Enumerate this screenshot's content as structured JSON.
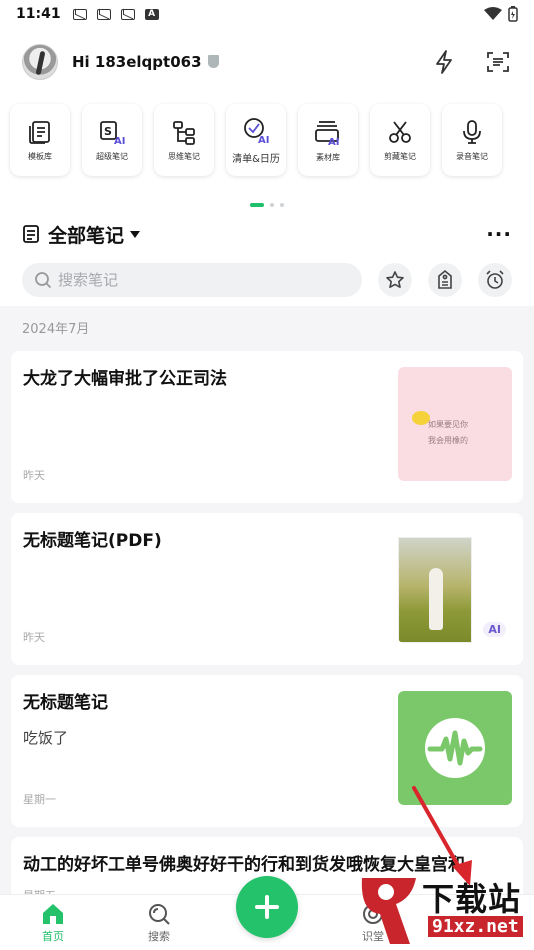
{
  "status": {
    "time": "11:41"
  },
  "header": {
    "username": "Hi 183elqpt063"
  },
  "tools": [
    {
      "label": "模板库",
      "icon": "template-library-icon"
    },
    {
      "label": "超级笔记",
      "icon": "super-note-ai-icon"
    },
    {
      "label": "思维笔记",
      "icon": "mind-map-icon"
    },
    {
      "label": "清单&日历",
      "icon": "checklist-calendar-ai-icon"
    },
    {
      "label": "素材库",
      "icon": "material-library-ai-icon"
    },
    {
      "label": "剪藏笔记",
      "icon": "clip-scissors-icon"
    },
    {
      "label": "录音笔记",
      "icon": "microphone-icon"
    }
  ],
  "section": {
    "title": "全部笔记",
    "more": "···"
  },
  "search": {
    "placeholder": "搜索笔记"
  },
  "date_group": "2024年7月",
  "notes": [
    {
      "title": "大龙了大幅审批了公正司法",
      "body": "",
      "date": "昨天",
      "thumb_text_1": "如果要见你",
      "thumb_text_2": "我会用橡的"
    },
    {
      "title": "无标题笔记(PDF)",
      "body": "",
      "date": "昨天",
      "badge": "AI"
    },
    {
      "title": "无标题笔记",
      "body": "吃饭了",
      "date": "星期一"
    },
    {
      "title": "动工的好坏工单号佛奥好好干的行和到货发哦恢复大皇宫和",
      "body": "",
      "date": "星期五"
    }
  ],
  "nav": [
    {
      "label": "首页",
      "icon": "home-icon"
    },
    {
      "label": "搜索",
      "icon": "search-icon"
    },
    {
      "label": "识堂",
      "icon": "target-icon"
    }
  ],
  "watermark": {
    "text1": "下载站",
    "text2": "91xz.net"
  },
  "colors": {
    "accent": "#23c26b",
    "background": "#f5f5f7"
  }
}
